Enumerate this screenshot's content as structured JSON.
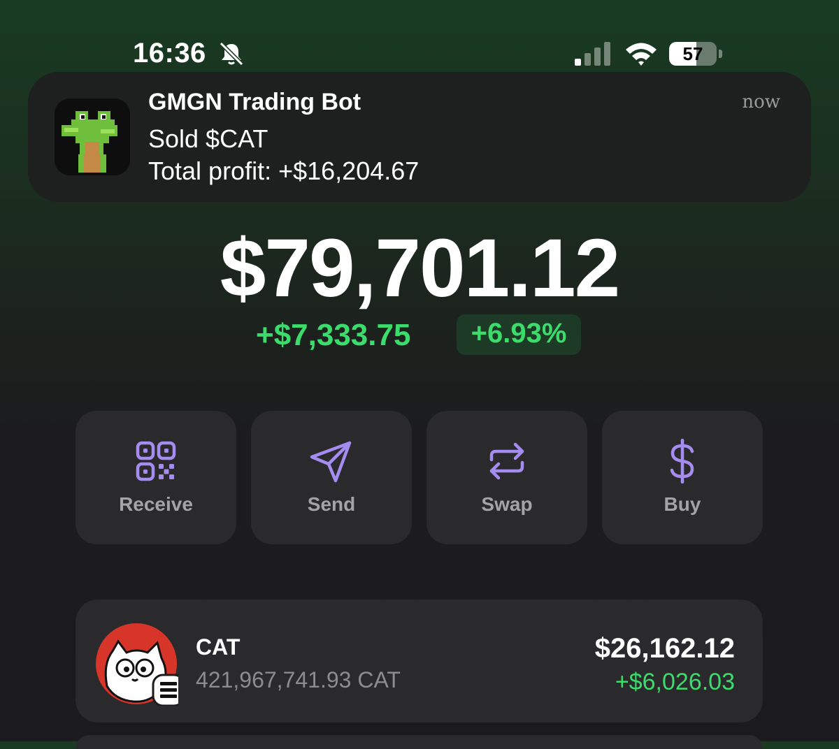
{
  "status_bar": {
    "time": "16:36",
    "battery_level": "57",
    "battery_fraction": 0.57,
    "icons": [
      "bell-slash-icon",
      "cellular-signal-icon",
      "wifi-icon",
      "battery-icon"
    ]
  },
  "notification": {
    "app_name": "GMGN Trading Bot",
    "line1": "Sold $CAT",
    "line2": "Total profit: +$16,204.67",
    "time": "now",
    "icon": "frog-app-icon"
  },
  "portfolio": {
    "balance": "$79,701.12",
    "change_amount": "+$7,333.75",
    "change_percent": "+6.93%"
  },
  "actions": [
    {
      "label": "Receive",
      "icon": "qr-code-icon"
    },
    {
      "label": "Send",
      "icon": "send-icon"
    },
    {
      "label": "Swap",
      "icon": "swap-arrows-icon"
    },
    {
      "label": "Buy",
      "icon": "dollar-icon"
    }
  ],
  "tokens": [
    {
      "name": "CAT",
      "amount": "421,967,741.93 CAT",
      "value": "$26,162.12",
      "change": "+$6,026.03",
      "icon": "cat-token-icon",
      "chain_badge": "solana-badge-icon"
    }
  ],
  "colors": {
    "accent_purple": "#a48cf0",
    "positive_green": "#3bdc6b",
    "card_bg": "#2a2a2d",
    "background_top": "#183b22",
    "background_bottom": "#1b1b1d"
  }
}
